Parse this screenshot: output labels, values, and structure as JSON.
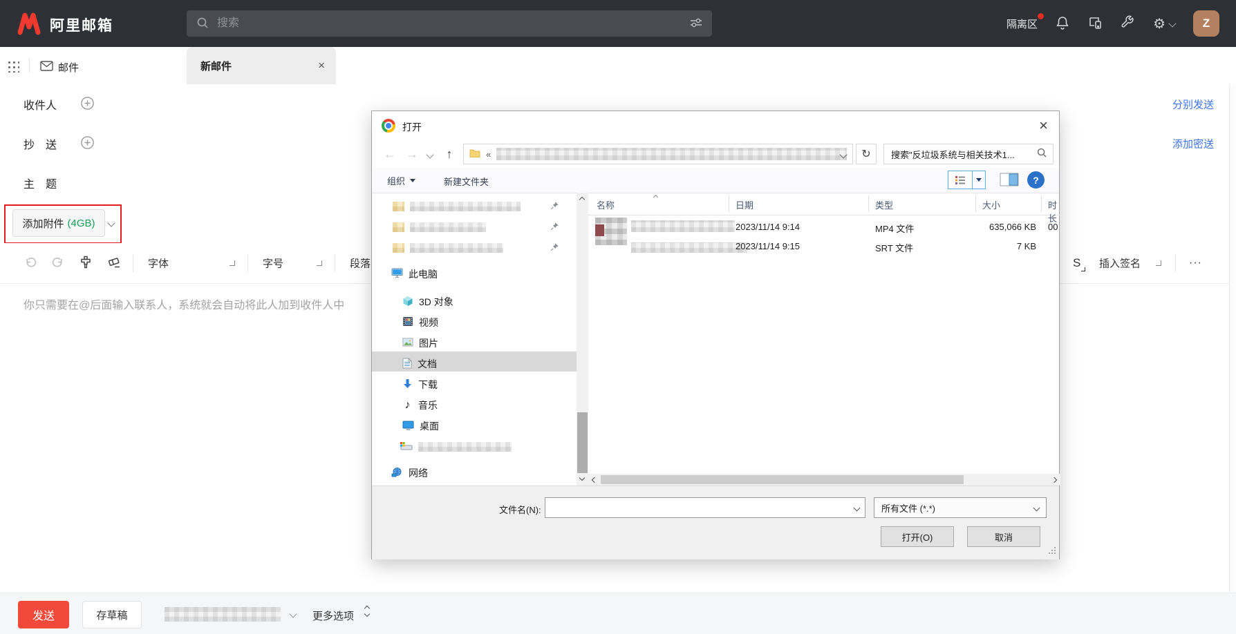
{
  "icons": {
    "close_tab": "×",
    "close_dialog": "×",
    "back": "←",
    "forward": "→",
    "up": "↑",
    "refresh": "↻",
    "address_chevrons": "«",
    "gear": "⚙",
    "more_h": "···",
    "music_note": "♪",
    "help": "?",
    "sig": "S"
  },
  "topbar": {
    "brand": "阿里邮箱",
    "search_placeholder": "搜索",
    "quarantine": "隔离区",
    "avatar": "Z"
  },
  "tabbar": {
    "mail": "邮件",
    "tab": "新邮件"
  },
  "compose": {
    "to": "收件人",
    "cc": "抄　送",
    "subject": "主　题",
    "send_separately": "分别发送",
    "add_bcc": "添加密送",
    "attach": "添加附件",
    "attach_quota": "(4GB)",
    "font": "字体",
    "size": "字号",
    "paragraph": "段落",
    "signature": "插入签名",
    "placeholder": "你只需要在@后面输入联系人，系统就会自动将此人加到收件人中",
    "send": "发送",
    "save_draft": "存草稿",
    "more_options": "更多选项"
  },
  "dialog": {
    "title": "打开",
    "search_value": "搜索\"反垃圾系统与相关技术1...",
    "organize": "组织",
    "new_folder": "新建文件夹",
    "columns": {
      "name": "名称",
      "date": "日期",
      "type": "类型",
      "size": "大小",
      "duration": "时长"
    },
    "files": [
      {
        "date": "2023/11/14 9:14",
        "type": "MP4 文件",
        "size": "635,066 KB",
        "duration": "00"
      },
      {
        "date": "2023/11/14 9:15",
        "type": "SRT 文件",
        "size": "7 KB",
        "duration": ""
      }
    ],
    "sidebar": {
      "this_pc": "此电脑",
      "objects_3d": "3D 对象",
      "videos": "视频",
      "pictures": "图片",
      "documents": "文档",
      "downloads": "下载",
      "music": "音乐",
      "desktop": "桌面",
      "network": "网络"
    },
    "filename_label": "文件名(N):",
    "filetype": "所有文件 (*.*)",
    "open": "打开(O)",
    "cancel": "取消"
  },
  "colors": {
    "brand_red": "#f0392f",
    "accent_red": "#f14a3c",
    "link_blue": "#3e74e6",
    "quota_green": "#16a05d",
    "annotation_red": "#e21b1b",
    "win_blue": "#2a71c7"
  }
}
